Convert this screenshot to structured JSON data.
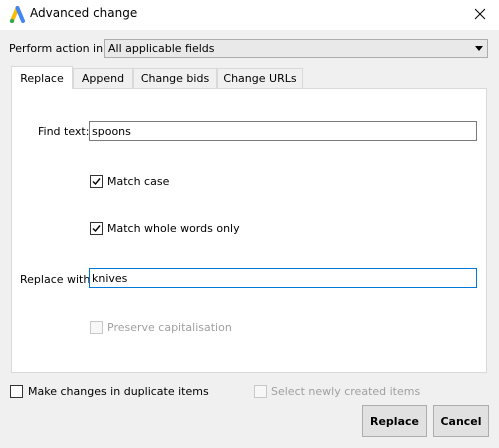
{
  "window": {
    "title": "Advanced change",
    "app_icon": "google-ads-logo",
    "close_icon": "close-icon"
  },
  "perform_action": {
    "label": "Perform action in:",
    "selected": "All applicable fields"
  },
  "tabs": [
    {
      "label": "Replace",
      "active": true
    },
    {
      "label": "Append",
      "active": false
    },
    {
      "label": "Change bids",
      "active": false
    },
    {
      "label": "Change URLs",
      "active": false
    }
  ],
  "replace": {
    "find_label": "Find text:",
    "find_value": "spoons",
    "match_case": {
      "label": "Match case",
      "checked": true
    },
    "match_whole_words": {
      "label": "Match whole words only",
      "checked": true
    },
    "replace_label": "Replace with:",
    "replace_value": "knives",
    "preserve_capitalisation": {
      "label": "Preserve capitalisation",
      "checked": false,
      "enabled": false
    }
  },
  "footer": {
    "duplicate_items": {
      "label": "Make changes in duplicate items",
      "checked": false
    },
    "select_new_items": {
      "label": "Select newly created items",
      "checked": false,
      "enabled": false
    },
    "replace_button": "Replace",
    "cancel_button": "Cancel"
  },
  "colors": {
    "accent_focus": "#0078d7",
    "logo_blue": "#4285f4",
    "logo_yellow": "#fbbc04",
    "logo_green": "#34a853"
  }
}
